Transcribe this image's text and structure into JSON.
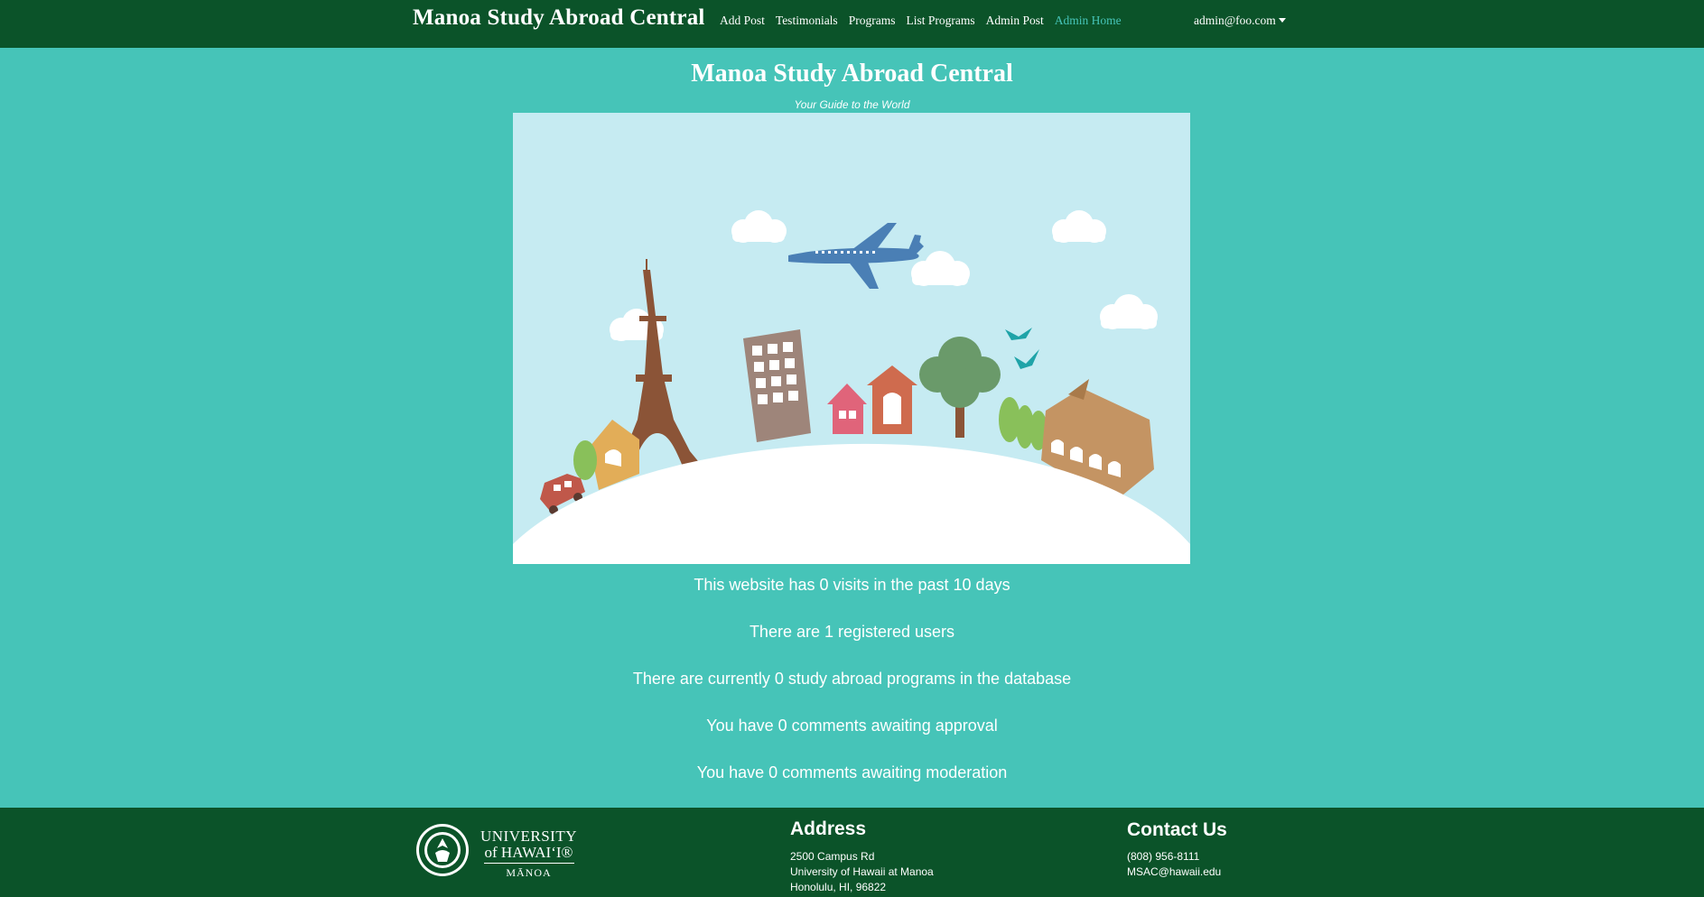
{
  "navbar": {
    "brand": "Manoa Study Abroad Central",
    "links": [
      {
        "label": "Add Post",
        "active": false
      },
      {
        "label": "Testimonials",
        "active": false
      },
      {
        "label": "Programs",
        "active": false
      },
      {
        "label": "List Programs",
        "active": false
      },
      {
        "label": "Admin Post",
        "active": false
      },
      {
        "label": "Admin Home",
        "active": true
      }
    ],
    "user": "admin@foo.com"
  },
  "hero": {
    "title": "Manoa Study Abroad Central",
    "subtitle": "Your Guide to the World"
  },
  "stats": [
    "This website has 0 visits in the past 10 days",
    "There are 1 registered users",
    "There are currently 0 study abroad programs in the database",
    "You have 0 comments awaiting approval",
    "You have 0 comments awaiting moderation"
  ],
  "footer": {
    "logo": {
      "line1": "UNIVERSITY",
      "line2": "of HAWAI‘I®",
      "line3": "MĀNOA"
    },
    "address": {
      "title": "Address",
      "lines": [
        "2500 Campus Rd",
        "University of Hawaii at Manoa",
        "Honolulu, HI, 96822"
      ]
    },
    "contact": {
      "title": "Contact Us",
      "lines": [
        "(808) 956-8111",
        "MSAC@hawaii.edu"
      ]
    }
  },
  "colors": {
    "navbar": "#0b5329",
    "background": "#46c4b8",
    "accent": "#46c4b8",
    "sky": "#c6ebf2"
  }
}
